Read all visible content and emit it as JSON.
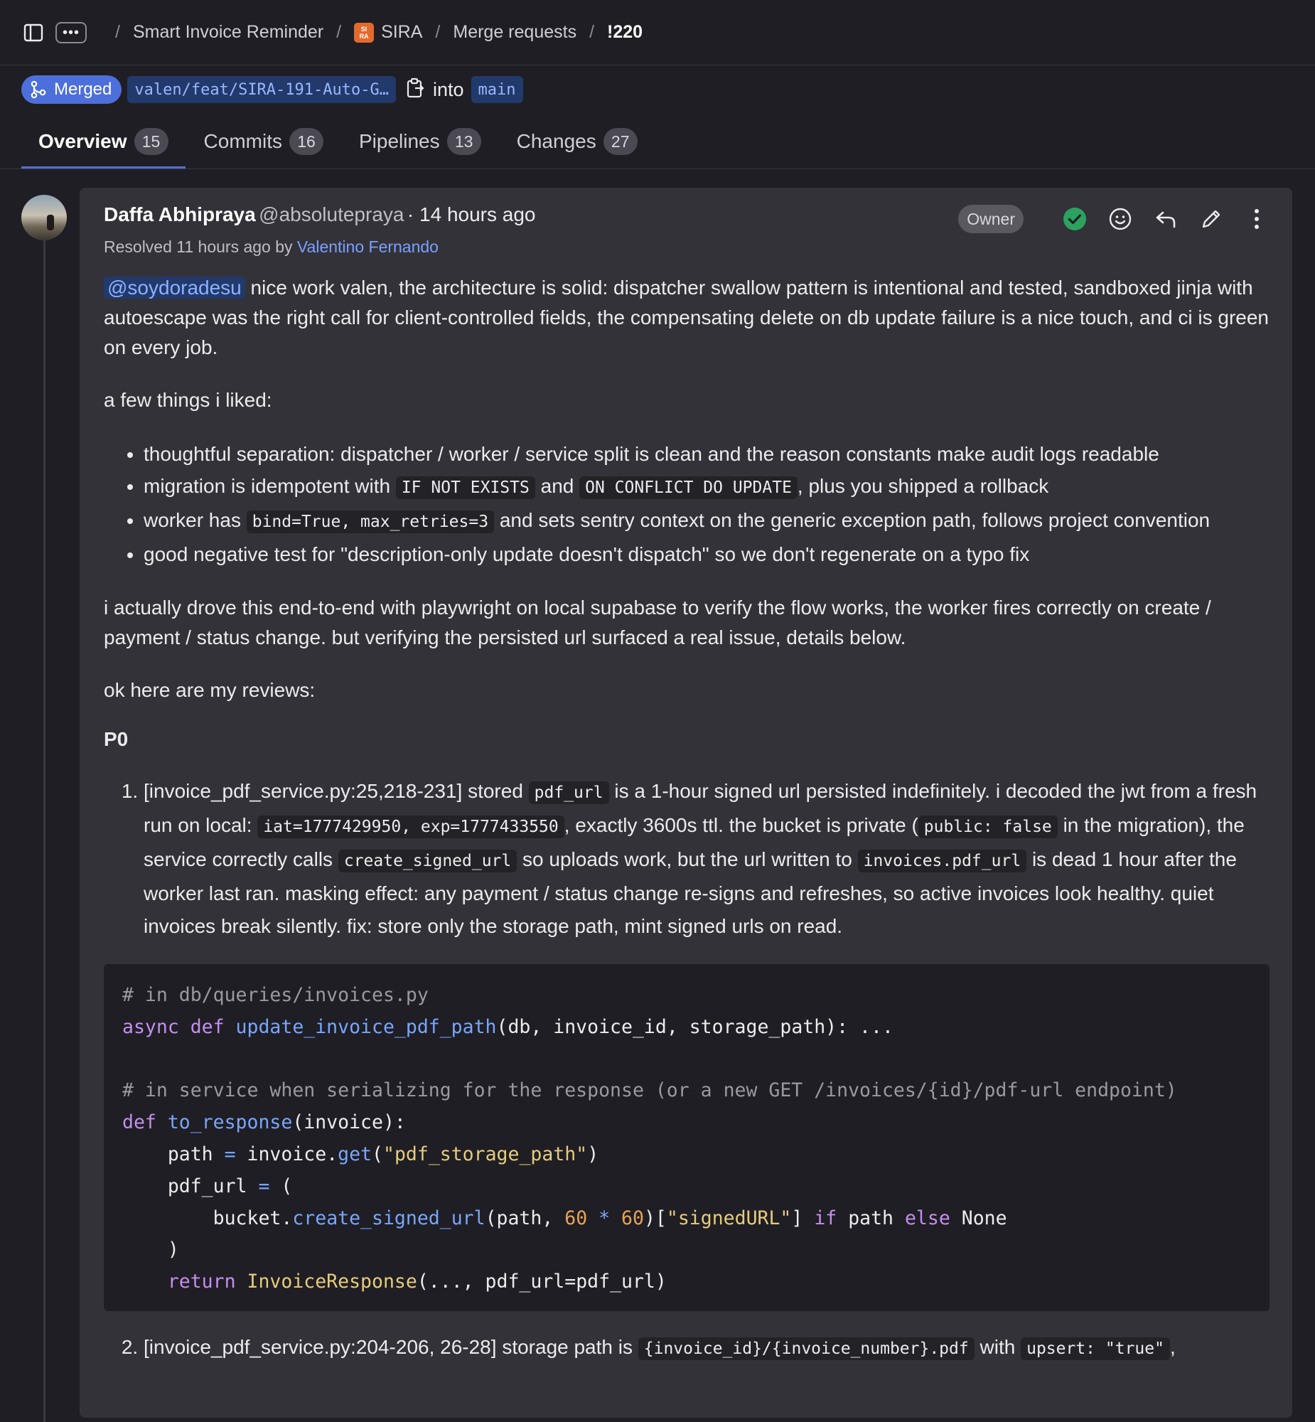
{
  "breadcrumb": {
    "project": "Smart Invoice Reminder",
    "group_logo": "SIRA",
    "group": "SIRA",
    "section": "Merge requests",
    "current": "!220",
    "separator": "/"
  },
  "mr": {
    "status": "Merged",
    "source_branch": "valen/feat/SIRA-191-Auto-G…",
    "into_label": "into",
    "target_branch": "main"
  },
  "tabs": [
    {
      "label": "Overview",
      "count": "15"
    },
    {
      "label": "Commits",
      "count": "16"
    },
    {
      "label": "Pipelines",
      "count": "13"
    },
    {
      "label": "Changes",
      "count": "27"
    }
  ],
  "comment": {
    "author": "Daffa Abhipraya",
    "handle": "@absolutepraya",
    "time": "· 14 hours ago",
    "resolved_prefix": "Resolved 11 hours ago by",
    "resolved_by": "Valentino Fernando",
    "role_badge": "Owner",
    "mention": "@soydoradesu",
    "intro": "nice work valen, the architecture is solid: dispatcher swallow pattern is intentional and tested, sandboxed jinja with autoescape was the right call for client-controlled fields, the compensating delete on db update failure is a nice touch, and ci is green on every job.",
    "liked_heading": "a few things i liked:",
    "liked": {
      "b1": "thoughtful separation: dispatcher / worker / service split is clean and the reason constants make audit logs readable",
      "b2_a": "migration is idempotent with",
      "b2_code1": "IF NOT EXISTS",
      "b2_b": "and",
      "b2_code2": "ON CONFLICT DO UPDATE",
      "b2_c": ", plus you shipped a rollback",
      "b3_a": "worker has",
      "b3_code": "bind=True, max_retries=3",
      "b3_b": "and sets sentry context on the generic exception path, follows project convention",
      "b4": "good negative test for \"description-only update doesn't dispatch\" so we don't regenerate on a typo fix"
    },
    "para2": "i actually drove this end-to-end with playwright on local supabase to verify the flow works, the worker fires correctly on create / payment / status change. but verifying the persisted url surfaced a real issue, details below.",
    "para3": "ok here are my reviews:",
    "priority": "P0",
    "item1": {
      "a": "[invoice_pdf_service.py:25,218-231] stored",
      "code1": "pdf_url",
      "b": "is a 1-hour signed url persisted indefinitely. i decoded the jwt from a fresh run on local:",
      "code2": "iat=1777429950, exp=1777433550",
      "c": ", exactly 3600s ttl. the bucket is private (",
      "code3": "public: false",
      "d": "in the migration), the service correctly calls",
      "code4": "create_signed_url",
      "e": "so uploads work, but the url written to",
      "code5": "invoices.pdf_url",
      "f": "is dead 1 hour after the worker last ran. masking effect: any payment / status change re-signs and refreshes, so active invoices look healthy. quiet invoices break silently. fix: store only the storage path, mint signed urls on read."
    },
    "code": {
      "l1": "# in db/queries/invoices.py",
      "l2_kw": "async def ",
      "l2_fn": "update_invoice_pdf_path",
      "l2_rest": "(db, invoice_id, storage_path): ...",
      "l4": "# in service when serializing for the response (or a new GET /invoices/{id}/pdf-url endpoint)",
      "l5_kw": "def ",
      "l5_fn": "to_response",
      "l5_rest": "(invoice):",
      "l6_a": "    path ",
      "l6_op": "=",
      "l6_b": " invoice.",
      "l6_fn": "get",
      "l6_c": "(",
      "l6_st": "\"pdf_storage_path\"",
      "l6_d": ")",
      "l7_a": "    pdf_url ",
      "l7_op": "=",
      "l7_b": " (",
      "l8_a": "        bucket.",
      "l8_fn": "create_signed_url",
      "l8_b": "(path, ",
      "l8_n1": "60",
      "l8_op": " * ",
      "l8_n2": "60",
      "l8_c": ")[",
      "l8_st": "\"signedURL\"",
      "l8_d": "] ",
      "l8_kw1": "if",
      "l8_e": " path ",
      "l8_kw2": "else",
      "l8_f": " None",
      "l9": "    )",
      "l10_kw": "    return ",
      "l10_cls": "InvoiceResponse",
      "l10_rest": "(..., pdf_url=pdf_url)"
    },
    "item2": {
      "a": "[invoice_pdf_service.py:204-206, 26-28] storage path is",
      "code1": "{invoice_id}/{invoice_number}.pdf",
      "b": "with",
      "code2": "upsert: \"true\"",
      "c": ","
    }
  },
  "colors": {
    "accent": "#4d6fdc",
    "link": "#7ba0ff",
    "success": "#2da160",
    "background": "#1f1e24",
    "card": "#333238"
  },
  "icons": [
    "sidebar-toggle-icon",
    "ellipsis-icon",
    "merge-icon",
    "copy-icon",
    "check-circle-icon",
    "emoji-icon",
    "reply-icon",
    "pencil-icon",
    "kebab-icon"
  ]
}
